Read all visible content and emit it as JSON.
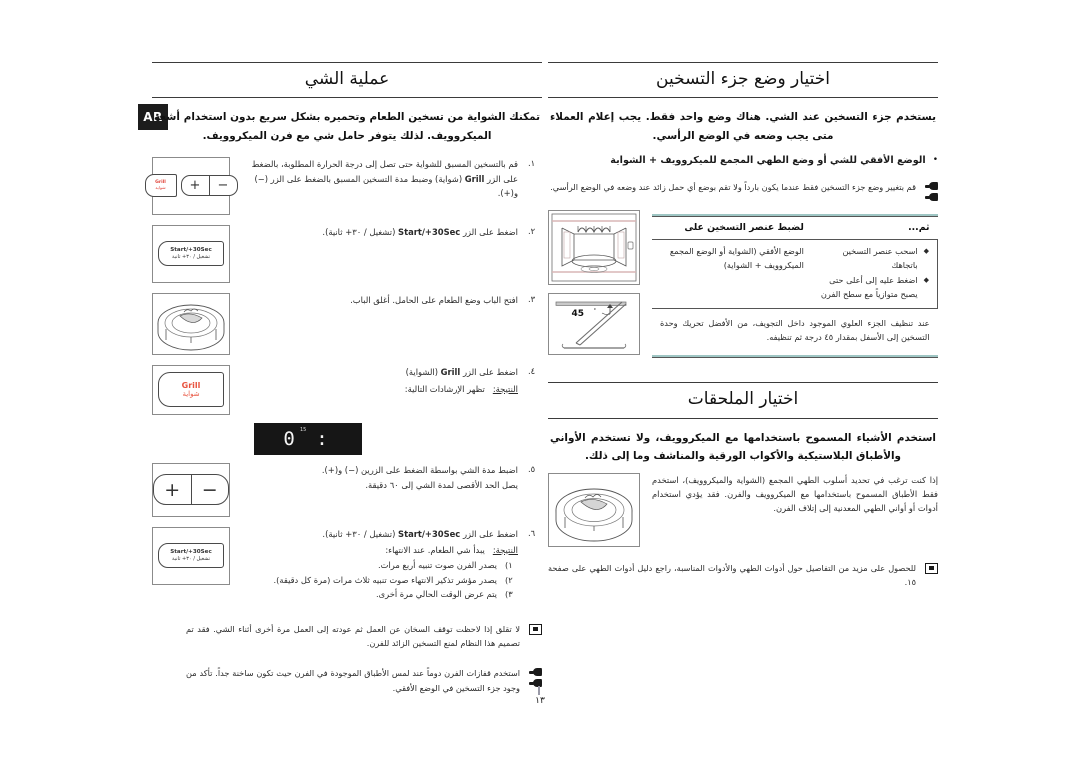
{
  "meta": {
    "language_tab": "AR",
    "page_number": "١٣"
  },
  "right_column": {
    "heading": "اختيار وضع جزء التسخين",
    "lead": "يستخدم جزء التسخين عند الشي. هناك وضع واحد فقط. يجب إعلام العملاء متى يجب وضعه في الوضع الرأسي.",
    "bullet": {
      "marker": "•",
      "text": "الوضع الأفقي للشي أو وضع الطهي المجمع للميكروويف + الشواية"
    },
    "note_top": "قم بتغيير وضع جزء التسخين فقط عندما يكون بارداً ولا تقم بوضع أي حمل زائد عند وضعه في الوضع الرأسي.",
    "table": {
      "header_left": "ثم...",
      "header_right": "لضبط عنصر التسخين على",
      "row": {
        "right": "الوضع الأفقي (الشواية أو الوضع المجمع الميكروويف + الشواية)",
        "left_items": [
          "اسحب عنصر التسخين باتجاهك",
          "اضغط عليه إلى أعلى حتى يصبح متوازياً مع سطح الفرن"
        ],
        "diamond": "◆"
      },
      "footnote": "عند تنظيف الجزء العلوي الموجود داخل التجويف، من الأفضل تحريك وحدة التسخين إلى الأسفل بمقدار ٤٥ درجة ثم تنظيفه."
    },
    "accessories": {
      "heading": "اختيار الملحقات",
      "lead": "استخدم الأشياء المسموح باستخدامها مع الميكروويف، ولا تستخدم الأواني والأطباق البلاستيكية والأكواب الورقية والمناشف وما إلى ذلك.",
      "para": "إذا كنت ترغب في تحديد أسلوب الطهي المجمع (الشواية والميكروويف)، استخدم فقط الأطباق المسموح باستخدامها مع الميكروويف والفرن. فقد يؤدي استخدام أدوات أو أواني الطهي المعدنية إلى إتلاف الفرن.",
      "note": "للحصول على مزيد من التفاصيل حول أدوات الطهي والأدوات المناسبة، راجع دليل أدوات الطهي على صفحة ١٥."
    },
    "illustrations": {
      "oven_cavity": "oven-cavity-diagram",
      "angle_label": "45",
      "angle_unit": "°",
      "heater_angle": "heater-45-degree-diagram",
      "dish_plate": "combination-dish-diagram"
    }
  },
  "left_column": {
    "heading": "عملية الشي",
    "lead": "تمكنك الشواية من تسخين الطعام وتحميره بشكل سريع بدون استخدام أشعة الميكروويف. لذلك يتوفر حامل شي مع فرن الميكروويف.",
    "steps": [
      {
        "num": "١.",
        "text_before": "قم بالتسخين المسبق للشواية حتى تصل إلى درجة الحرارة المطلوبة، بالضغط على الزر ",
        "btn": "Grill",
        "text_after": " (شواية) وضبط مدة التسخين المسبق بالضغط على الزر (−) و(+).",
        "illustration": "plus-minus-and-grill-buttons"
      },
      {
        "num": "٢.",
        "text_before": "اضغط على الزر ",
        "btn": "Start/+30Sec",
        "text_after": " (تشغيل / ٣٠+ ثانية).",
        "illustration": "start-30sec-button"
      },
      {
        "num": "٣.",
        "text_before": "افتح الباب وضع الطعام على الحامل. أغلق الباب.",
        "btn": "",
        "text_after": "",
        "illustration": "food-on-rack-diagram"
      },
      {
        "num": "٤.",
        "text_before": "اضغط على الزر ",
        "btn": "Grill",
        "text_after": " (الشواية)",
        "result_label": "النتيجة:",
        "result_text": "تظهر الإرشادات التالية:",
        "illustration": "grill-button"
      },
      {
        "num": "٥.",
        "text_before": "اضبط مدة الشي بواسطة الضغط على الزرين (−) و(+).",
        "btn": "",
        "text_after": "",
        "extra": "يصل الحد الأقصى لمدة الشي إلى ٦٠ دقيقة.",
        "illustration": "plus-minus-buttons-large"
      },
      {
        "num": "٦.",
        "text_before": "اضغط على الزر ",
        "btn": "Start/+30Sec",
        "text_after": " (تشغيل / ٣٠+ ثانية).",
        "result_label": "النتيجة:",
        "result_text": "يبدأ شي الطعام. عند الانتهاء:",
        "sub_items": [
          {
            "num": "١)",
            "text": "يصدر الفرن صوت تنبيه أربع مرات."
          },
          {
            "num": "٢)",
            "text": "يصدر مؤشر تذكير الانتهاء صوت تنبيه ثلاث مرات (مرة كل دقيقة)."
          },
          {
            "num": "٣)",
            "text": "يتم عرض الوقت الحالي مرة أخرى."
          }
        ],
        "illustration": "start-30sec-button"
      }
    ],
    "display": {
      "segments": "0 :",
      "mini_indicator": "15"
    },
    "notes": [
      {
        "icon": "square-note-icon",
        "text": "لا تقلق إذا لاحظت توقف السخان عن العمل ثم عودته إلى العمل مرة أخرى أثناء الشي. فقد تم تصميم هذا النظام لمنع التسخين الزائد للفرن."
      },
      {
        "icon": "hand-note-icon",
        "text": "استخدم قفازات الفرن دوماً عند لمس الأطباق الموجودة في الفرن حيث تكون ساخنة جداً. تأكد من وجود جزء التسخين في الوضع الأفقي."
      }
    ],
    "buttons": {
      "minus": "−",
      "plus": "+",
      "grill_en": "Grill",
      "grill_ar": "شواية",
      "start_en": "Start/+30Sec",
      "start_ar": "تشغيل / ٣٠+ ثانية"
    }
  }
}
